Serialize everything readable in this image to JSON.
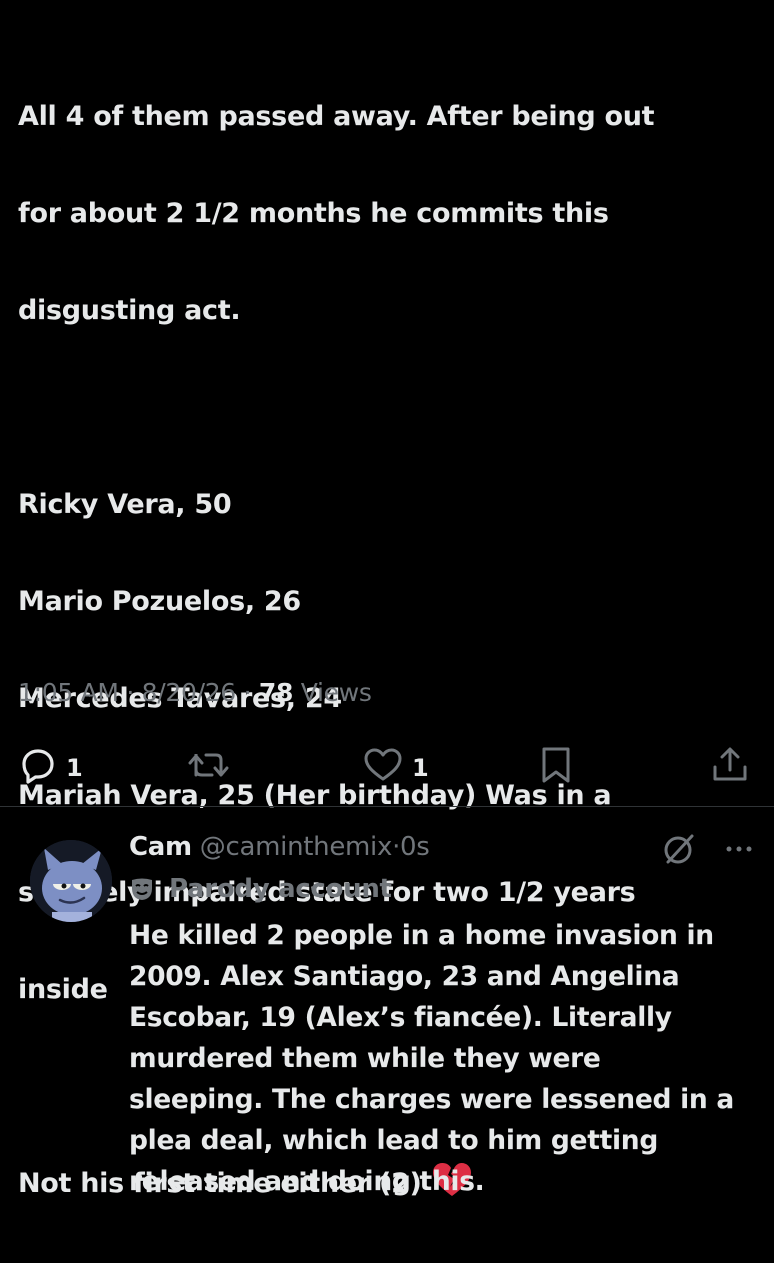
{
  "post": {
    "lines": [
      "All 4 of them passed away. After being out",
      "for about 2 1/2 months he commits this",
      "disgusting act.",
      "",
      "Ricky Vera, 50",
      "Mario Pozuelos, 26",
      "Mercedes Tavares, 24",
      "Mariah Vera, 25 (Her birthday) Was in a",
      "severely impaired state for two 1/2 years",
      "inside",
      "",
      "Not his first time either (2)"
    ],
    "emoji": "broken-heart-icon",
    "time": "1:05 AM",
    "date": "8/20/26",
    "views_count": "78",
    "views_label": "Views",
    "sep": "·"
  },
  "actions": {
    "replies": "1",
    "likes": "1"
  },
  "reply": {
    "name": "Cam",
    "handle": "@caminthemix",
    "time": "0s",
    "badge": "Parody account",
    "lines": [
      "He killed 2 people in a home invasion in",
      "2009. Alex Santiago, 23 and Angelina",
      "Escobar, 19 (Alex’s fiancée). Literally",
      "murdered them while they were",
      "sleeping. The charges were lessened in a",
      "plea deal,  which lead to him getting",
      "released and doing this."
    ]
  },
  "colors": {
    "background": "#000000",
    "text": "#e7e9ea",
    "muted": "#71767b",
    "divider": "#2f3336"
  }
}
